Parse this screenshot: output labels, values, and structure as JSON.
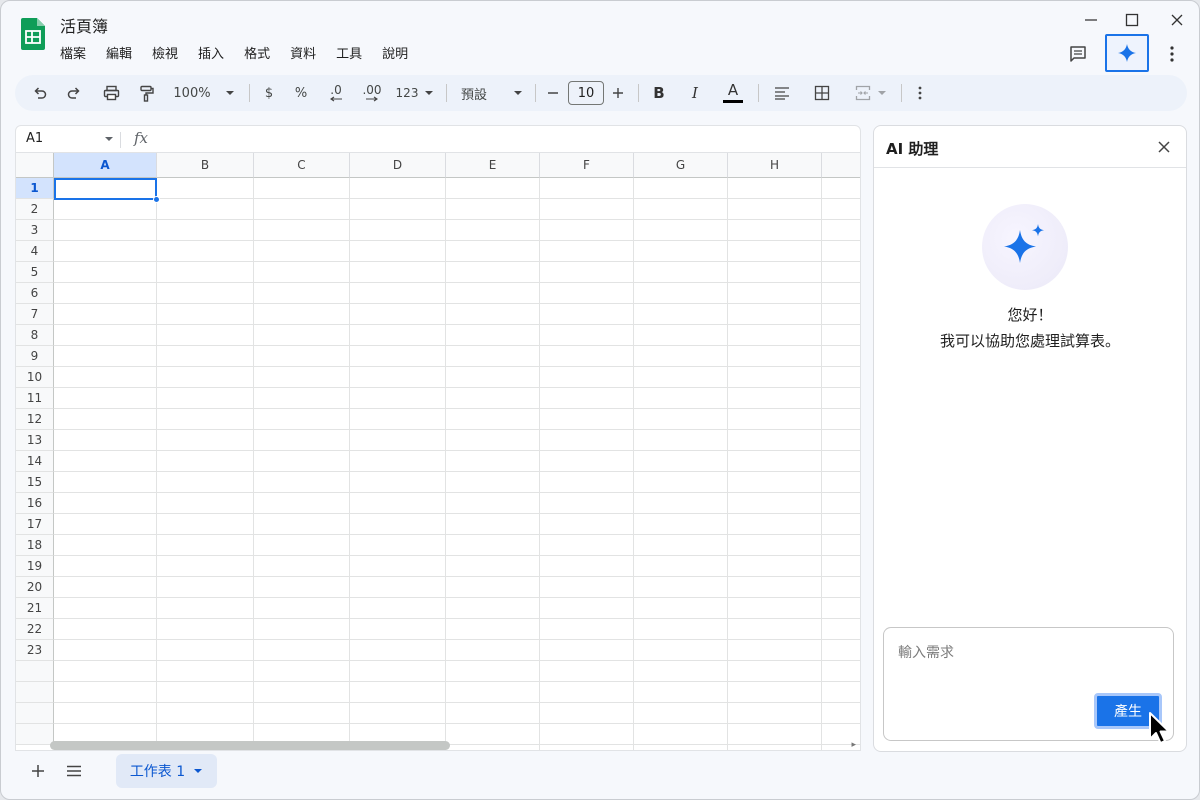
{
  "app": {
    "document_title": "活頁簿",
    "brand_color": "#0f9d58",
    "accent_color": "#1a73e8"
  },
  "menu": {
    "items": [
      "檔案",
      "編輯",
      "檢視",
      "插入",
      "格式",
      "資料",
      "工具",
      "說明"
    ]
  },
  "toolbar": {
    "zoom": "100%",
    "currency_symbol": "$",
    "percent_symbol": "%",
    "decrease_decimal": ".0",
    "increase_decimal": ".00",
    "number_format": "123",
    "font_family": "預設",
    "font_size": "10",
    "bold": "B",
    "italic": "I",
    "text_color_letter": "A"
  },
  "formula_bar": {
    "cell_reference": "A1",
    "fx_label": "fx"
  },
  "grid": {
    "columns": [
      "A",
      "B",
      "C",
      "D",
      "E",
      "F",
      "G",
      "H"
    ],
    "rows": [
      "1",
      "2",
      "3",
      "4",
      "5",
      "6",
      "7",
      "8",
      "9",
      "10",
      "11",
      "12",
      "13",
      "14",
      "15",
      "16",
      "17",
      "18",
      "19",
      "20",
      "21",
      "22",
      "23"
    ],
    "selected_cell": "A1"
  },
  "sheets": {
    "tabs": [
      {
        "label": "工作表 1",
        "active": true
      }
    ]
  },
  "ai_panel": {
    "title": "AI 助理",
    "greeting": "您好！",
    "subtitle": "我可以協助您處理試算表。",
    "input_placeholder": "輸入需求",
    "input_value": "",
    "generate_label": "產生"
  },
  "icons": {
    "app": "sheets-logo-icon",
    "comment": "comment-icon",
    "ai": "sparkle-icon",
    "more": "more-vert-icon"
  }
}
